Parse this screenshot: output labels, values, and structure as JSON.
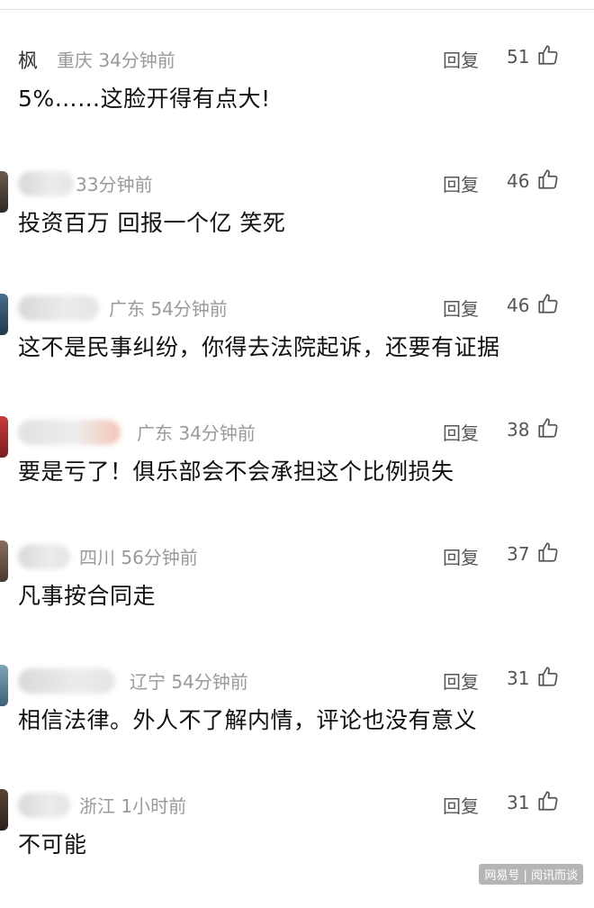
{
  "comments": [
    {
      "user": "枫",
      "location_time": "重庆 34分钟前",
      "reply_label": "回复",
      "likes": "51",
      "text": "5%……这脸开得有点大!"
    },
    {
      "user": "",
      "location_time": "33分钟前",
      "reply_label": "回复",
      "likes": "46",
      "text": "投资百万 回报一个亿  笑死"
    },
    {
      "user": "",
      "location_time": "广东 54分钟前",
      "reply_label": "回复",
      "likes": "46",
      "text": "这不是民事纠纷，你得去法院起诉，还要有证据"
    },
    {
      "user": "",
      "location_time": "广东 34分钟前",
      "reply_label": "回复",
      "likes": "38",
      "text": "要是亏了！俱乐部会不会承担这个比例损失"
    },
    {
      "user": "",
      "location_time": "四川 56分钟前",
      "reply_label": "回复",
      "likes": "37",
      "text": "凡事按合同走"
    },
    {
      "user": "",
      "location_time": "辽宁 54分钟前",
      "reply_label": "回复",
      "likes": "31",
      "text": "相信法律。外人不了解内情，评论也没有意义"
    },
    {
      "user": "",
      "location_time": "浙江 1小时前",
      "reply_label": "回复",
      "likes": "31",
      "text": "不可能"
    }
  ],
  "watermark": "网易号 | 阅讯而谈",
  "colors": {
    "meta_gray": "#9a9a9a",
    "text_dark": "#111111",
    "divider": "#e2e2e2"
  },
  "icons": {
    "like": "thumbs-up-icon"
  }
}
